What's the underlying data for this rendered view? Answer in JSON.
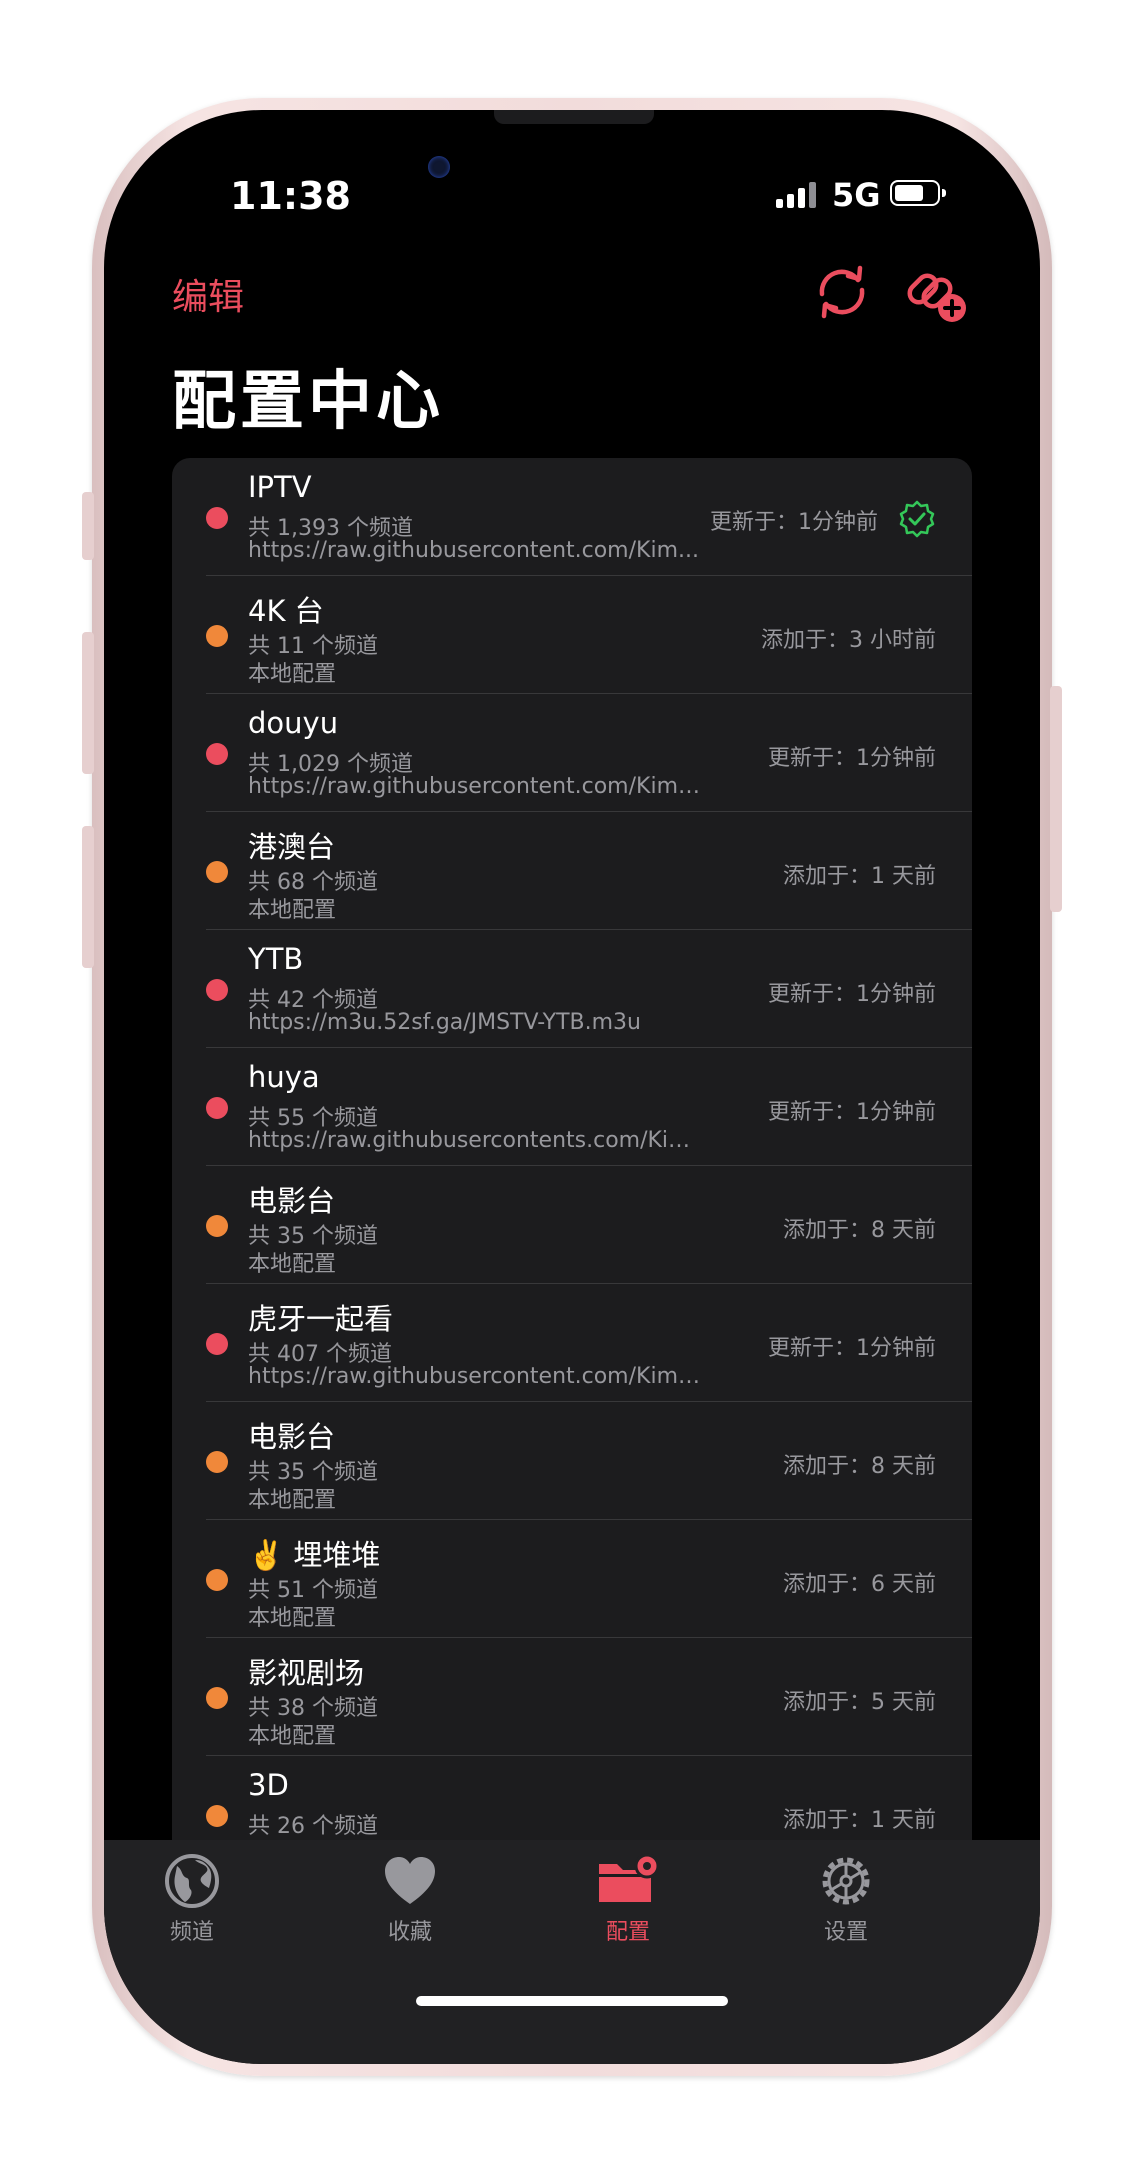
{
  "status_bar": {
    "time": "11:38",
    "network": "5G"
  },
  "nav": {
    "edit_label": "编辑",
    "title": "配置中心"
  },
  "items": [
    {
      "name": "IPTV",
      "count": "共 1,393 个频道",
      "source": "https://raw.githubusercontent.com/Kim...",
      "time": "更新于：1分钟前",
      "dot": "red",
      "verified": true
    },
    {
      "name": "4K 台",
      "count": "共 11 个频道",
      "source": "本地配置",
      "time": "添加于：3 小时前",
      "dot": "orange"
    },
    {
      "name": "douyu",
      "count": "共 1,029 个频道",
      "source": "https://raw.githubusercontent.com/Kimenta...",
      "time": "更新于：1分钟前",
      "dot": "red"
    },
    {
      "name": "港澳台",
      "count": "共 68 个频道",
      "source": "本地配置",
      "time": "添加于：1 天前",
      "dot": "orange"
    },
    {
      "name": "YTB",
      "count": "共 42 个频道",
      "source": "https://m3u.52sf.ga/JMSTV-YTB.m3u",
      "time": "更新于：1分钟前",
      "dot": "red"
    },
    {
      "name": "huya",
      "count": "共 55 个频道",
      "source": "https://raw.githubusercontents.com/Kimenta...",
      "time": "更新于：1分钟前",
      "dot": "red"
    },
    {
      "name": "电影台",
      "count": "共 35 个频道",
      "source": "本地配置",
      "time": "添加于：8 天前",
      "dot": "orange"
    },
    {
      "name": "虎牙一起看",
      "count": "共 407 个频道",
      "source": "https://raw.githubusercontent.com/Kimenta...",
      "time": "更新于：1分钟前",
      "dot": "red"
    },
    {
      "name": "电影台",
      "count": "共 35 个频道",
      "source": "本地配置",
      "time": "添加于：8 天前",
      "dot": "orange"
    },
    {
      "name": "✌️ 埋堆堆",
      "count": "共 51 个频道",
      "source": "本地配置",
      "time": "添加于：6 天前",
      "dot": "orange"
    },
    {
      "name": "影视剧场",
      "count": "共 38 个频道",
      "source": "本地配置",
      "time": "添加于：5 天前",
      "dot": "orange"
    },
    {
      "name": "3D",
      "count": "共 26 个频道",
      "source": "",
      "time": "添加于：1 天前",
      "dot": "orange"
    }
  ],
  "tabs": [
    {
      "label": "频道",
      "icon": "globe-icon"
    },
    {
      "label": "收藏",
      "icon": "heart-icon"
    },
    {
      "label": "配置",
      "icon": "folder-gear-icon",
      "active": true
    },
    {
      "label": "设置",
      "icon": "gear-icon"
    }
  ],
  "colors": {
    "accent": "#eb4d5e",
    "orange": "#f0883a",
    "verified": "#34c759"
  }
}
